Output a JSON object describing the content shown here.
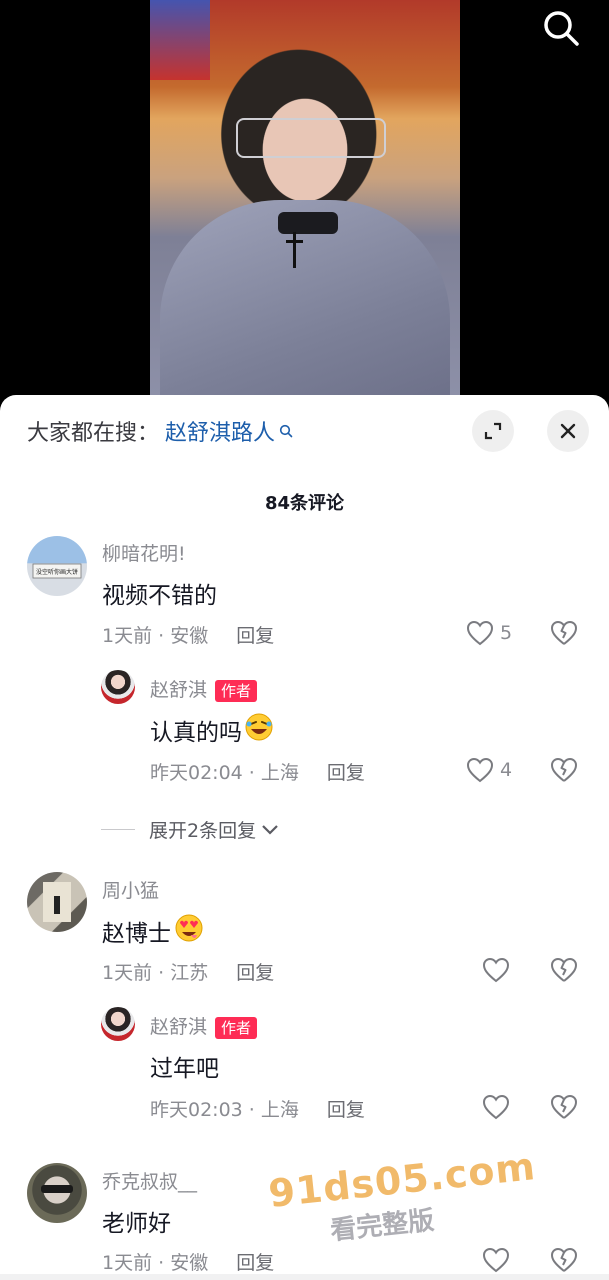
{
  "video": {
    "search_icon": "search-icon"
  },
  "panel": {
    "suggest_prefix": "大家都在搜：",
    "suggest_term": "赵舒淇路人",
    "expand_icon": "expand-icon",
    "close_icon": "close-icon",
    "comment_count": "84条评论"
  },
  "comments": [
    {
      "user": "柳暗花明!",
      "text": "视频不错的",
      "time": "1天前 · 安徽",
      "reply": "回复",
      "likes": "5"
    },
    {
      "user": "赵舒淇",
      "badge": "作者",
      "text": "认真的吗",
      "time": "昨天02:04 · 上海",
      "reply": "回复",
      "likes": "4"
    },
    {
      "expand": "展开2条回复"
    },
    {
      "user": "周小猛",
      "text": "赵博士",
      "time": "1天前 · 江苏",
      "reply": "回复"
    },
    {
      "user": "赵舒淇",
      "badge": "作者",
      "text": "过年吧",
      "time": "昨天02:03 · 上海",
      "reply": "回复"
    },
    {
      "user": "乔克叔叔__",
      "text": "老师好",
      "time": "1天前 · 安徽",
      "reply": "回复"
    }
  ],
  "watermark": {
    "main": "91ds05.com",
    "sub": "看完整版"
  },
  "avatar_sign": "没空听你画大饼"
}
